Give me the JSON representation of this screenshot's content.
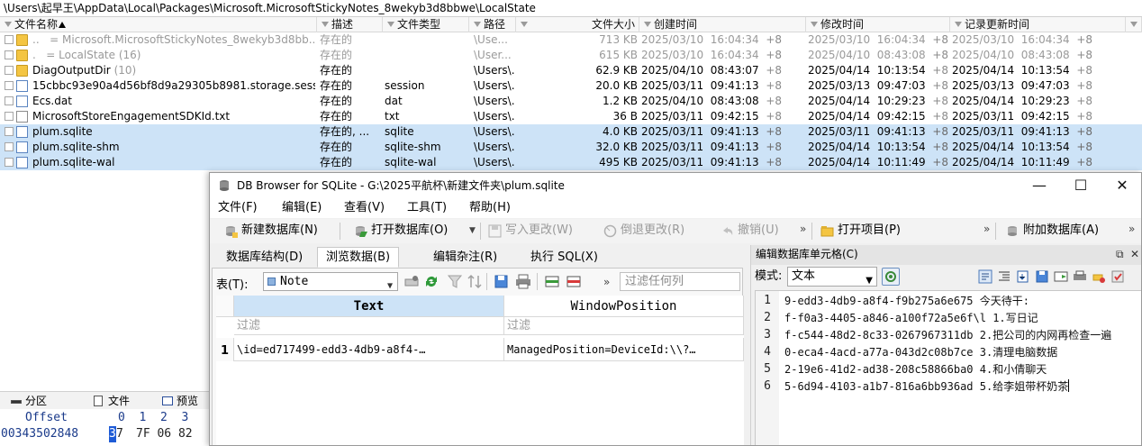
{
  "explorer": {
    "path": "\\Users\\起早王\\AppData\\Local\\Packages\\Microsoft.MicrosoftStickyNotes_8wekyb3d8bbwe\\LocalState",
    "columns": {
      "name": "文件名称",
      "desc": "描述",
      "type": "文件类型",
      "path": "路径",
      "size": "文件大小",
      "created": "创建时间",
      "modified": "修改时间",
      "record": "记录更新时间"
    },
    "rows": [
      {
        "name": "Microsoft.MicrosoftStickyNotes_8wekyb3d8bb...",
        "prefix": "..   =",
        "desc": "存在的",
        "type": "",
        "path": "\\Use...",
        "size": "713 KB",
        "created": "2025/03/10  16:04:34",
        "ctz": "+8",
        "modified": "2025/03/10  16:04:34",
        "mtz": "+8",
        "record": "2025/03/10  16:04:34",
        "rtz": "+8"
      },
      {
        "name": "LocalState",
        "count": "(16)",
        "prefix": ".   =",
        "desc": "存在的",
        "type": "",
        "path": "\\User...",
        "size": "615 KB",
        "created": "2025/03/10  16:04:34",
        "ctz": "+8",
        "modified": "2025/04/10  08:43:08",
        "mtz": "+8",
        "record": "2025/04/10  08:43:08",
        "rtz": "+8"
      },
      {
        "name": "DiagOutputDir",
        "count": "(10)",
        "desc": "存在的",
        "type": "",
        "path": "\\Users\\...",
        "size": "62.9 KB",
        "created": "2025/04/10  08:43:07",
        "ctz": "+8",
        "modified": "2025/04/14  10:13:54",
        "mtz": "+8",
        "record": "2025/04/14  10:13:54",
        "rtz": "+8"
      },
      {
        "name": "15cbbc93e90a4d56bf8d9a29305b8981.storage.sessi...",
        "desc": "存在的",
        "type": "session",
        "path": "\\Users\\...",
        "size": "20.0 KB",
        "created": "2025/03/11  09:41:13",
        "ctz": "+8",
        "modified": "2025/03/13  09:47:03",
        "mtz": "+8",
        "record": "2025/03/13  09:47:03",
        "rtz": "+8"
      },
      {
        "name": "Ecs.dat",
        "desc": "存在的",
        "type": "dat",
        "path": "\\Users\\...",
        "size": "1.2 KB",
        "created": "2025/04/10  08:43:08",
        "ctz": "+8",
        "modified": "2025/04/14  10:29:23",
        "mtz": "+8",
        "record": "2025/04/14  10:29:23",
        "rtz": "+8"
      },
      {
        "name": "MicrosoftStoreEngagementSDKId.txt",
        "desc": "存在的",
        "type": "txt",
        "path": "\\Users\\...",
        "size": "36 B",
        "created": "2025/03/11  09:42:15",
        "ctz": "+8",
        "modified": "2025/04/14  09:42:15",
        "mtz": "+8",
        "record": "2025/03/11  09:42:15",
        "rtz": "+8"
      },
      {
        "name": "plum.sqlite",
        "desc": "存在的, ...",
        "type": "sqlite",
        "path": "\\Users\\...",
        "size": "4.0 KB",
        "created": "2025/03/11  09:41:13",
        "ctz": "+8",
        "modified": "2025/03/11  09:41:13",
        "mtz": "+8",
        "record": "2025/03/11  09:41:13",
        "rtz": "+8"
      },
      {
        "name": "plum.sqlite-shm",
        "desc": "存在的",
        "type": "sqlite-shm",
        "path": "\\Users\\...",
        "size": "32.0 KB",
        "created": "2025/03/11  09:41:13",
        "ctz": "+8",
        "modified": "2025/04/14  10:13:54",
        "mtz": "+8",
        "record": "2025/04/14  10:13:54",
        "rtz": "+8"
      },
      {
        "name": "plum.sqlite-wal",
        "desc": "存在的",
        "type": "sqlite-wal",
        "path": "\\Users\\...",
        "size": "495 KB",
        "created": "2025/03/11  09:41:13",
        "ctz": "+8",
        "modified": "2025/04/14  10:11:49",
        "mtz": "+8",
        "record": "2025/04/14  10:11:49",
        "rtz": "+8"
      }
    ],
    "bottom_tabs": [
      "分区",
      "文件",
      "预览"
    ],
    "hex": {
      "offset_label": "Offset",
      "col_headers": "0  1  2  3",
      "offset": "00343502848",
      "first_nibble": "3",
      "rest_first": "7",
      "bytes": "7F 06 82"
    }
  },
  "db_window": {
    "title": "DB Browser for SQLite - G:\\2025平航杯\\新建文件夹\\plum.sqlite",
    "controls": {
      "minimize": "—",
      "maximize": "☐",
      "close": "✕"
    },
    "menu": [
      "文件(F)",
      "编辑(E)",
      "查看(V)",
      "工具(T)",
      "帮助(H)"
    ],
    "toolbar": {
      "new_db": "新建数据库(N)",
      "open_db": "打开数据库(O)",
      "write": "写入更改(W)",
      "revert": "倒退更改(R)",
      "undo": "撤销(U)",
      "open_project": "打开项目(P)",
      "attach_db": "附加数据库(A)",
      "more": "»"
    },
    "tabs": [
      "数据库结构(D)",
      "浏览数据(B)",
      "编辑杂注(R)",
      "执行 SQL(X)"
    ],
    "browse": {
      "table_label": "表(T):",
      "table_value": "Note",
      "filter_placeholder": "过滤任何列",
      "more": "»",
      "columns": [
        "Text",
        "WindowPosition"
      ],
      "filter_text": "过滤",
      "row_number": "1",
      "row": {
        "text": "\\id=ed717499-edd3-4db9-a8f4-…",
        "window_position": "ManagedPosition=DeviceId:\\\\?…"
      }
    },
    "editor": {
      "title": "编辑数据库单元格(C)",
      "controls": {
        "float": "⧉",
        "close": "✕"
      },
      "mode_label": "模式:",
      "mode_value": "文本",
      "lines": [
        {
          "num": "1",
          "text": "9-edd3-4db9-a8f4-f9b275a6e675 今天待干:"
        },
        {
          "num": "2",
          "text": "f-f0a3-4405-a846-a100f72a5e6f\\l 1.写日记"
        },
        {
          "num": "3",
          "text": "f-c544-48d2-8c33-0267967311db 2.把公司的内网再检查一遍"
        },
        {
          "num": "4",
          "text": "0-eca4-4acd-a77a-043d2c08b7ce 3.清理电脑数据"
        },
        {
          "num": "5",
          "text": "2-19e6-41d2-ad38-208c58866ba0 4.和小倩聊天"
        },
        {
          "num": "6",
          "text": "5-6d94-4103-a1b7-816a6bb936ad 5.给李姐带杯奶茶"
        }
      ]
    }
  }
}
